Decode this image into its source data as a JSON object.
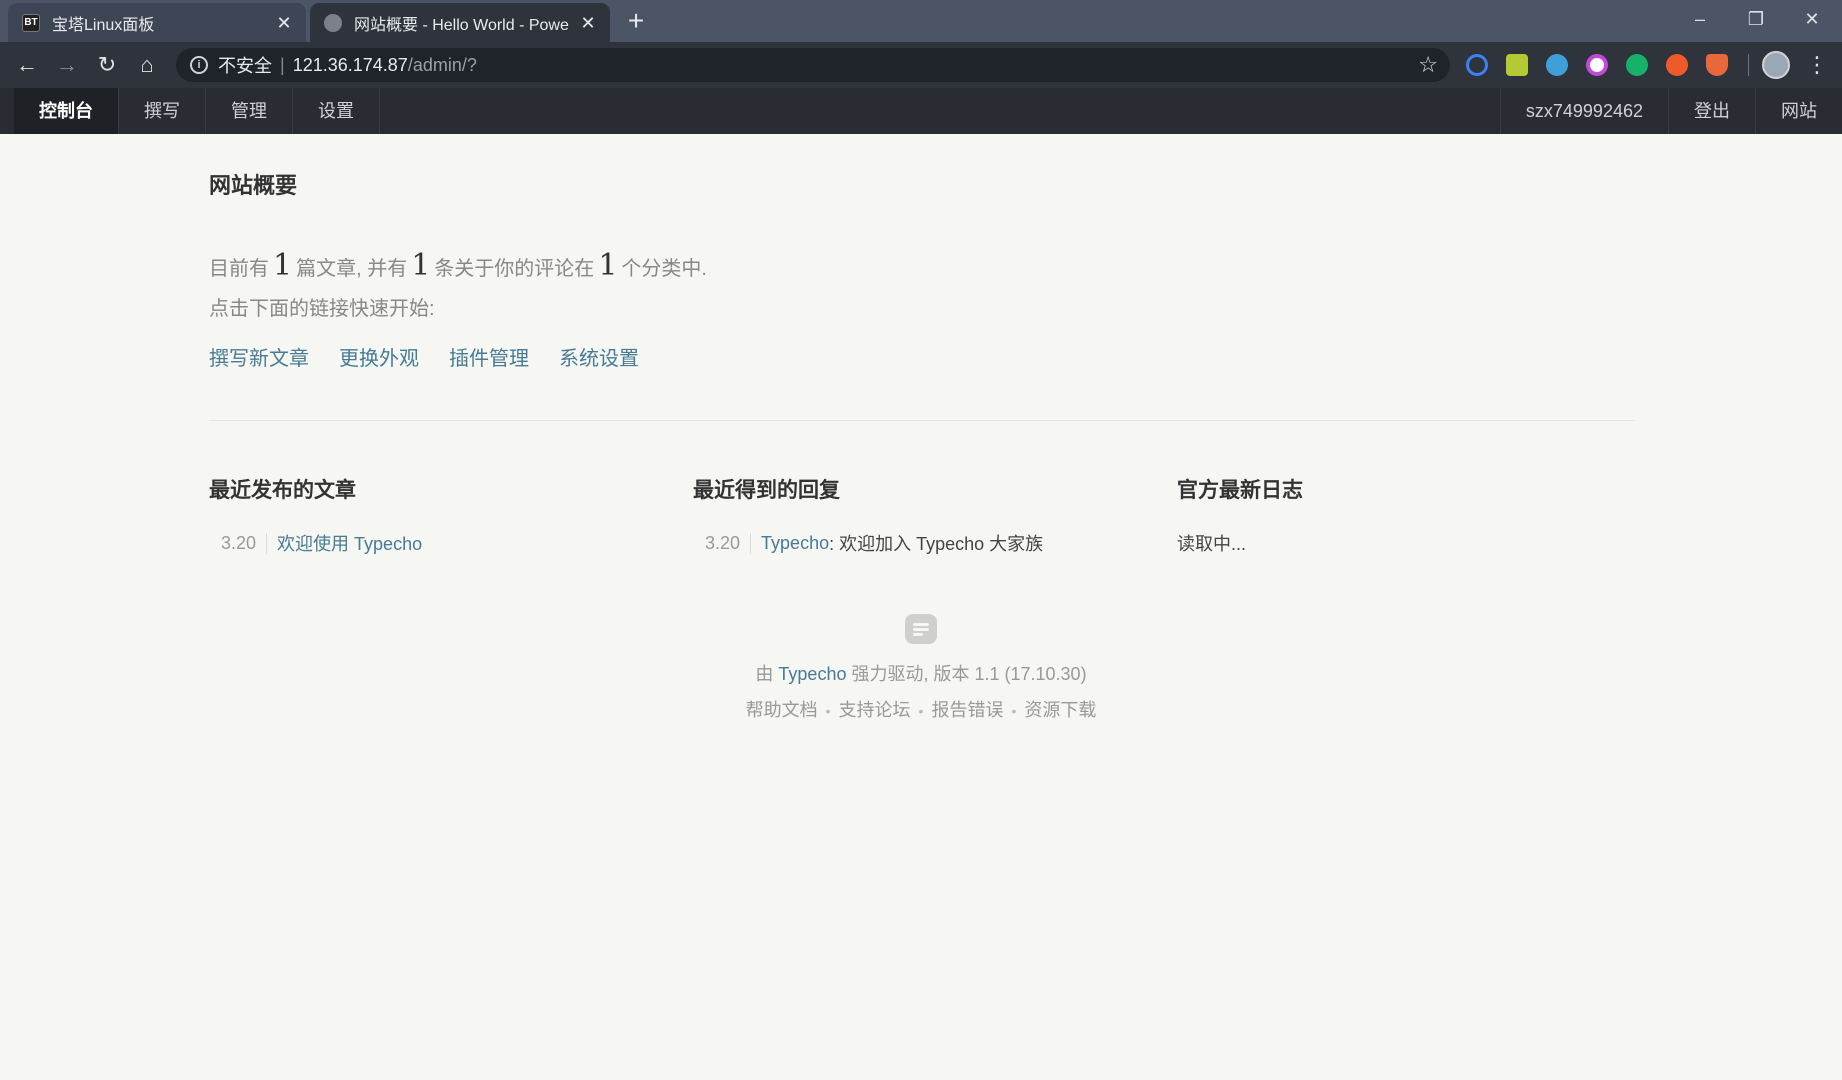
{
  "browser": {
    "tabs": [
      {
        "favicon_text": "BT",
        "title": "宝塔Linux面板",
        "active": false
      },
      {
        "favicon_text": "",
        "title": "网站概要 - Hello World - Powe",
        "active": true
      }
    ],
    "url_security": "不安全",
    "url_host": "121.36.174.87",
    "url_path": "/admin/?",
    "icons": {
      "back": "arrow-left-icon",
      "forward": "arrow-right-icon",
      "reload": "reload-icon",
      "home": "home-icon",
      "bookmark": "star-icon",
      "menu": "kebab-menu-icon"
    },
    "extension_colors": [
      "#3b82f6",
      "#b5c934",
      "#3fa0d8",
      "#c04ad6",
      "#17b26a",
      "#f05a28",
      "#e8683c"
    ]
  },
  "nav": {
    "left": [
      "控制台",
      "撰写",
      "管理",
      "设置"
    ],
    "right": [
      "szx749992462",
      "登出",
      "网站"
    ]
  },
  "page": {
    "title": "网站概要",
    "summary": {
      "p1": "目前有",
      "posts": "1",
      "p2": "篇文章, 并有",
      "comments": "1",
      "p3": "条关于你的评论在",
      "categories": "1",
      "p4": "个分类中."
    },
    "quickstart": "点击下面的链接快速开始:",
    "quicklinks": [
      "撰写新文章",
      "更换外观",
      "插件管理",
      "系统设置"
    ],
    "columns": {
      "posts": {
        "title": "最近发布的文章",
        "items": [
          {
            "date": "3.20",
            "text": "欢迎使用 Typecho"
          }
        ]
      },
      "comments": {
        "title": "最近得到的回复",
        "items": [
          {
            "date": "3.20",
            "author": "Typecho",
            "text": ": 欢迎加入 Typecho 大家族"
          }
        ]
      },
      "log": {
        "title": "官方最新日志",
        "loading": "读取中..."
      }
    }
  },
  "footer": {
    "p1": "由",
    "brand": "Typecho",
    "p2": "强力驱动, 版本 1.1 (17.10.30)",
    "links": [
      "帮助文档",
      "支持论坛",
      "报告错误",
      "资源下载"
    ]
  },
  "colors": {
    "link": "#467b96",
    "nav_bg": "#292d33",
    "page_bg": "#f6f6f3"
  }
}
